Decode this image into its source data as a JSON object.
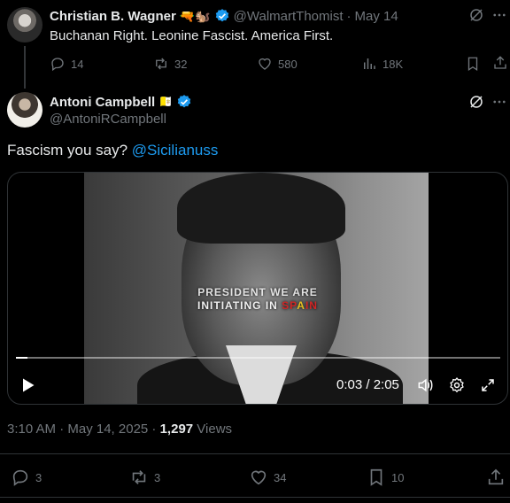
{
  "parent_tweet": {
    "display_name": "Christian B. Wagner",
    "emoji": "🔫🐿️",
    "handle": "@WalmartThomist",
    "separator": "·",
    "date": "May 14",
    "text": "Buchanan Right. Leonine Fascist. America First.",
    "replies": "14",
    "retweets": "32",
    "likes": "580",
    "views": "18K"
  },
  "main_tweet": {
    "display_name": "Antoni Campbell",
    "emoji": "🇻🇦",
    "handle": "@AntoniRCampbell",
    "text_prefix": "Fascism you say?",
    "mention": "@Sicilianuss",
    "video": {
      "caption_line1": "PRESIDENT WE ARE",
      "caption_line2_a": "INITIATING IN ",
      "caption_line2_b": "SP",
      "caption_line2_c": "A",
      "caption_line2_d": "IN",
      "time": "0:03 / 2:05",
      "progress": 0.024
    },
    "timestamp": "3:10 AM · May 14, 2025 · ",
    "views_count": "1,297",
    "views_label": " Views",
    "replies": "3",
    "retweets": "3",
    "likes": "34",
    "bookmarks": "10"
  },
  "colors": {
    "accent": "#1d9bf0",
    "verified": "#1d9bf0",
    "muted": "#71767b",
    "text": "#e7e9ea",
    "background": "#000000"
  }
}
